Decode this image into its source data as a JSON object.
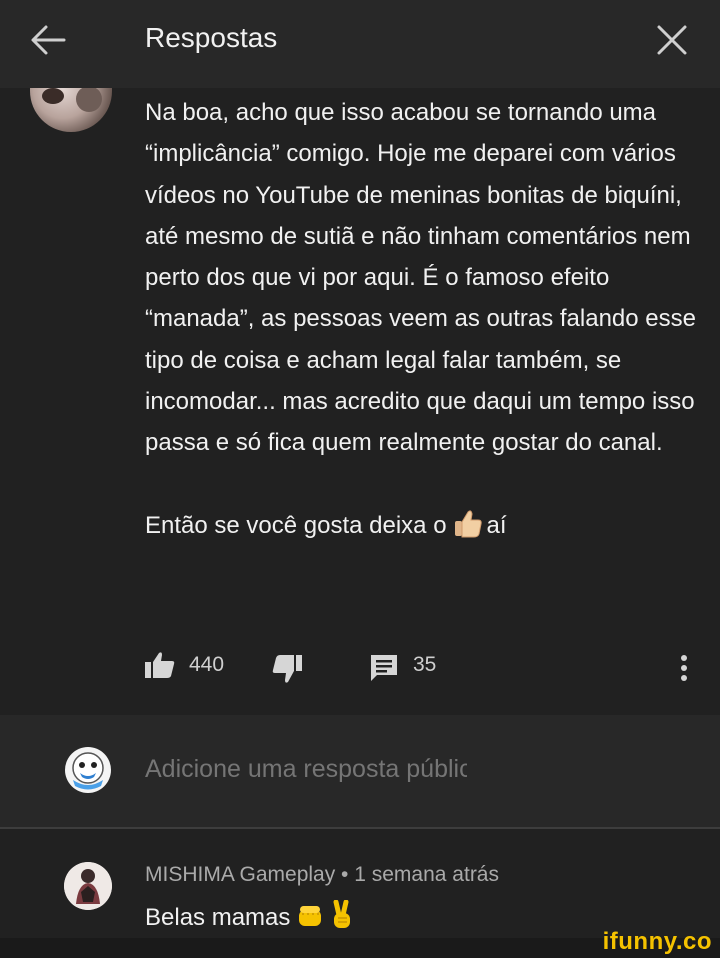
{
  "header": {
    "title": "Respostas",
    "back_icon": "arrow-left-icon",
    "close_icon": "close-icon"
  },
  "comment": {
    "paragraph1": "Na boa, acho que isso acabou se tornando uma “implicância” comigo. Hoje me deparei com vários vídeos no YouTube de meninas bonitas de biquíni, até mesmo de sutiã e não tinham comentários nem perto dos que vi por aqui. É o famoso efeito “manada”, as pessoas veem as outras falando esse tipo de coisa e acham legal falar também, se incomodar... mas acredito que daqui um tempo isso passa e só fica quem realmente gostar do canal.",
    "paragraph2_before": "Então se você gosta deixa o",
    "paragraph2_emoji": "thumbs-up-emoji",
    "paragraph2_after": "aí",
    "like_count": "440",
    "reply_count": "35"
  },
  "reply_box": {
    "placeholder": "Adicione uma resposta pública..."
  },
  "reply": {
    "meta": "MISHIMA Gameplay • 1 semana atrás",
    "text": "Belas mamas",
    "emojis": [
      "fist-emoji",
      "victory-hand-emoji"
    ]
  },
  "watermark": "ifunny.co",
  "colors": {
    "background": "#212121",
    "header": "#282828",
    "text": "#f1f1f1",
    "secondary_text": "#aaaaaa",
    "watermark": "#f5c200"
  }
}
